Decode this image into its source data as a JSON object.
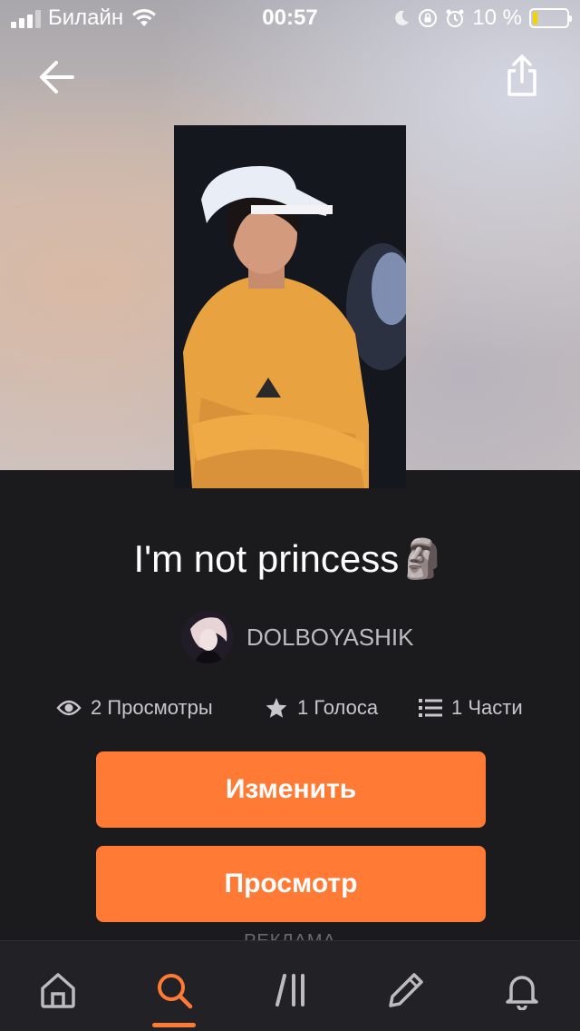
{
  "status_bar": {
    "carrier": "Билайн",
    "time": "00:57",
    "battery_percent": "10 %"
  },
  "story": {
    "title": "I'm not princess🗿",
    "author": "DOLBOYASHIK",
    "stats": {
      "views": "2 Просмотры",
      "votes": "1 Голоса",
      "parts": "1 Части"
    }
  },
  "actions": {
    "edit_label": "Изменить",
    "view_label": "Просмотр"
  },
  "ad_label": "РЕКЛАМА",
  "tabbar": {
    "items": [
      "home-icon",
      "search-icon",
      "library-icon",
      "write-icon",
      "notifications-icon"
    ],
    "active": "search-icon"
  },
  "colors": {
    "accent": "#ff7a35",
    "background": "#1b1a1d"
  }
}
